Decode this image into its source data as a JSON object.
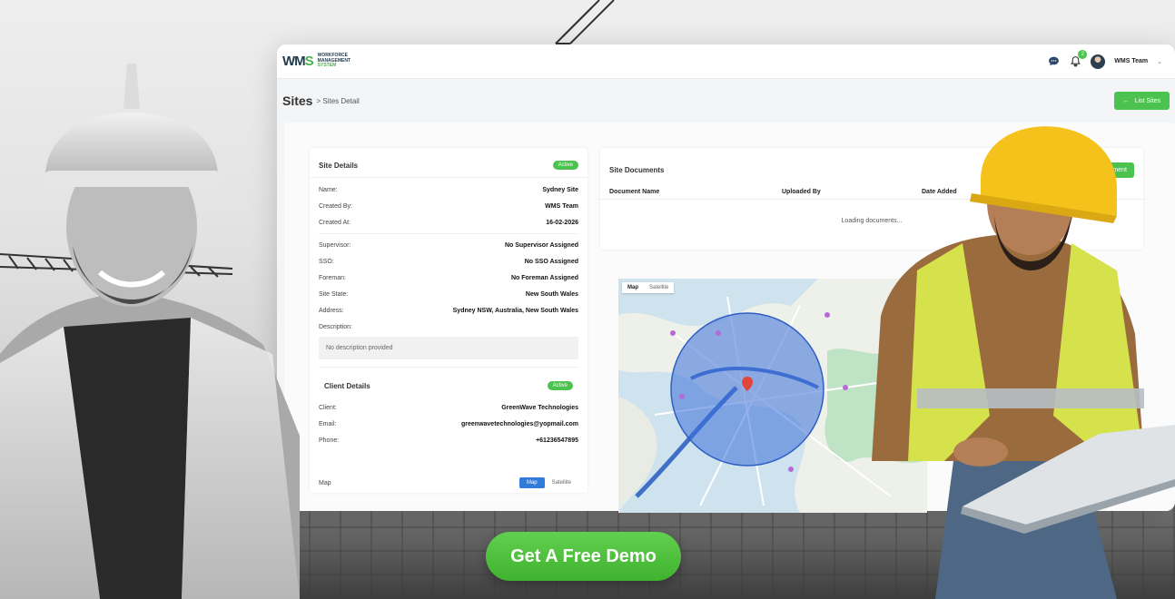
{
  "app": {
    "logo": {
      "mark_w": "WM",
      "mark_s": "S",
      "line1": "WORKFORCE",
      "line2": "MANAGEMENT",
      "line3": "SYSTEM"
    },
    "notifications_count": "2",
    "user_name": "WMS Team"
  },
  "page": {
    "title": "Sites",
    "breadcrumb": "> Sites Detail",
    "list_button": "List Sites",
    "list_icon": "arrow-left-icon"
  },
  "site_details": {
    "title": "Site Details",
    "status": "Active",
    "rows_top": [
      {
        "k": "Name:",
        "v": "Sydney Site"
      },
      {
        "k": "Created By:",
        "v": "WMS Team"
      },
      {
        "k": "Created At:",
        "v": "16-02-2026"
      }
    ],
    "rows_mid": [
      {
        "k": "Supervisor:",
        "v": "No Supervisor Assigned"
      },
      {
        "k": "SSO:",
        "v": "No SSO Assigned"
      },
      {
        "k": "Foreman:",
        "v": "No Foreman Assigned"
      },
      {
        "k": "Site State:",
        "v": "New South Wales"
      },
      {
        "k": "Address:",
        "v": "Sydney NSW, Australia, New South Wales"
      },
      {
        "k": "Description:",
        "v": ""
      }
    ],
    "description": "No description provided"
  },
  "client_details": {
    "title": "Client Details",
    "status": "Active",
    "rows": [
      {
        "k": "Client:",
        "v": "GreenWave Technologies"
      },
      {
        "k": "Email:",
        "v": "greenwavetechnologies@yopmail.com"
      },
      {
        "k": "Phone:",
        "v": "+61236547895"
      }
    ],
    "map_label": "Map",
    "map_toggle": [
      "Map",
      "Satellite"
    ]
  },
  "documents": {
    "title": "Site Documents",
    "add_button": "ument",
    "columns": [
      "Document Name",
      "Uploaded By",
      "Date Added"
    ],
    "loading": "Loading documents..."
  },
  "map": {
    "toggle": [
      "Map",
      "Satellite"
    ]
  },
  "cta": "Get A Free Demo",
  "colors": {
    "accent": "#4cc24f",
    "brand_dark": "#1f3a4c",
    "map_radius": "#3a6fd8"
  }
}
